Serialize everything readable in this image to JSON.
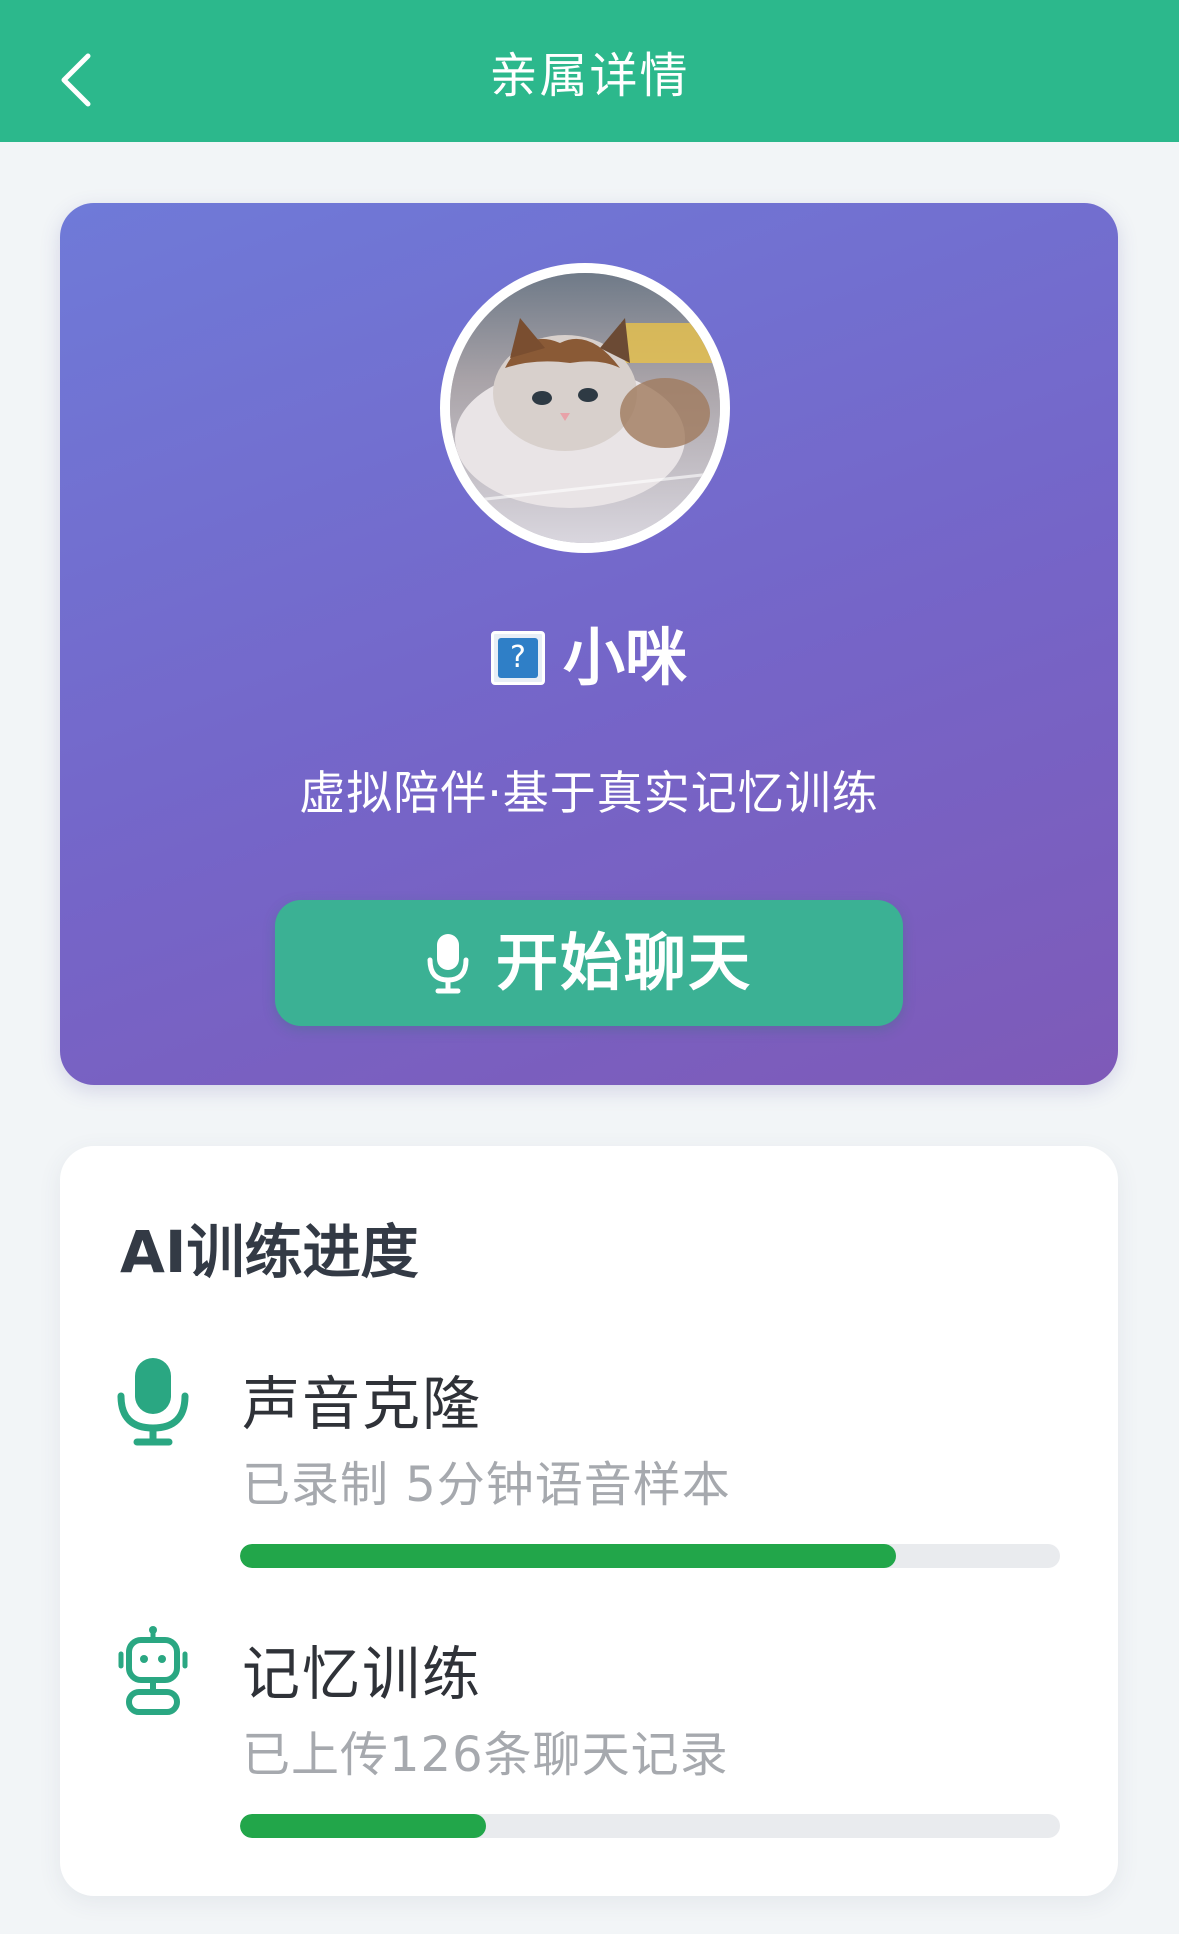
{
  "header": {
    "title": "亲属详情",
    "back_icon": "chevron-left-icon",
    "background": "#2cb88c"
  },
  "profile": {
    "avatar_alt": "cat photo",
    "emoji_glyph": "?",
    "name": "小咪",
    "subtitle": "虚拟陪伴·基于真实记忆训练",
    "chat_button_label": "开始聊天",
    "chat_button_icon": "microphone-icon",
    "gradient": [
      "#6f7ad8",
      "#7e5ab8"
    ],
    "button_color": "#3bb194"
  },
  "training": {
    "title": "AI训练进度",
    "items": [
      {
        "icon": "microphone-icon",
        "title": "声音克隆",
        "description": "已录制 5分钟语音样本",
        "progress": 0.8
      },
      {
        "icon": "robot-icon",
        "title": "记忆训练",
        "description": "已上传126条聊天记录",
        "progress": 0.3
      }
    ],
    "accent": "#22a64a",
    "icon_color": "#2aa782"
  }
}
